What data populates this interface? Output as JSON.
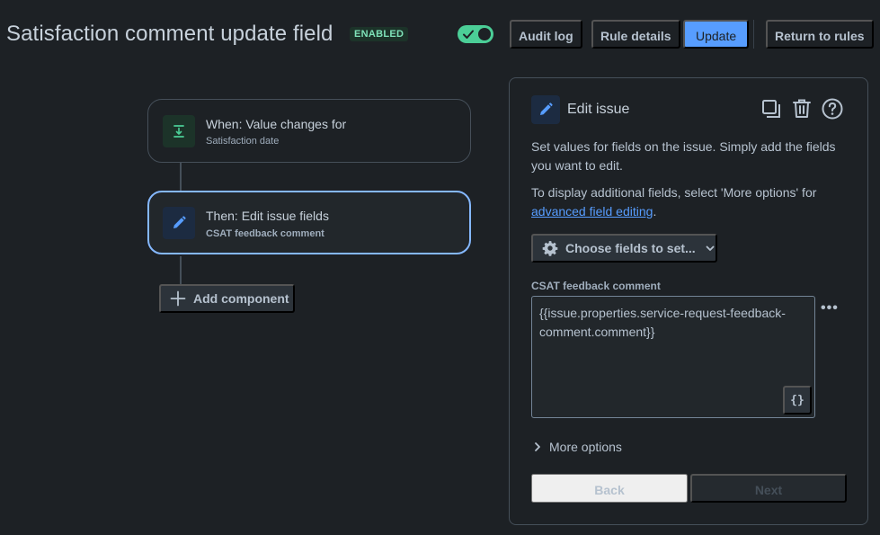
{
  "header": {
    "title": "Satisfaction comment update field",
    "status_badge": "ENABLED",
    "toggle_enabled": true,
    "audit_log_label": "Audit log",
    "rule_details_label": "Rule details",
    "update_label": "Update",
    "return_label": "Return to rules"
  },
  "flow": {
    "trigger": {
      "title": "When: Value changes for",
      "subtitle": "Satisfaction date",
      "icon": "field-change-icon"
    },
    "action": {
      "title": "Then: Edit issue fields",
      "subtitle": "CSAT feedback comment",
      "icon": "pencil-icon"
    },
    "add_component_label": "Add component"
  },
  "panel": {
    "title": "Edit issue",
    "description": "Set values for fields on the issue. Simply add the fields you want to edit.",
    "additional_prefix": "To display additional fields, select 'More options' for ",
    "additional_link": "advanced field editing",
    "additional_suffix": ".",
    "choose_fields_label": "Choose fields to set...",
    "field": {
      "label": "CSAT feedback comment",
      "value": "{{issue.properties.service-request-feedback-comment.comment}}",
      "smart_value_button": "{}"
    },
    "more_options_label": "More options",
    "back_label": "Back",
    "next_label": "Next"
  },
  "colors": {
    "background": "#1d2125",
    "primary": "#579dff",
    "success": "#4bce97",
    "selected_border": "#85b8ff"
  }
}
